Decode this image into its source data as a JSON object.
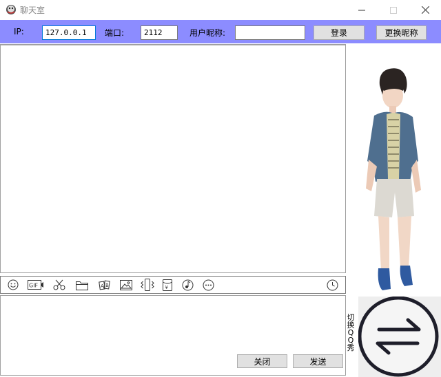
{
  "window": {
    "title": "聊天室"
  },
  "toolbar": {
    "ip_label": "IP:",
    "ip_value": "127.0.0.1",
    "port_label": "端口:",
    "port_value": "2112",
    "nick_label": "用户昵称:",
    "nick_value": "",
    "login_label": "登录",
    "change_nick_label": "更换昵称",
    "bg_color": "#8c8cff"
  },
  "toolicons": [
    "smile-icon",
    "gif-icon",
    "scissors-icon",
    "folder-icon",
    "magic-font-icon",
    "image-icon",
    "shake-icon",
    "red-packet-icon",
    "music-icon",
    "more-icon",
    "history-clock-icon"
  ],
  "bottom": {
    "close_label": "关闭",
    "send_label": "发送"
  },
  "side": {
    "switch_label": [
      "切",
      "换",
      "Q",
      "Q",
      "秀"
    ]
  }
}
